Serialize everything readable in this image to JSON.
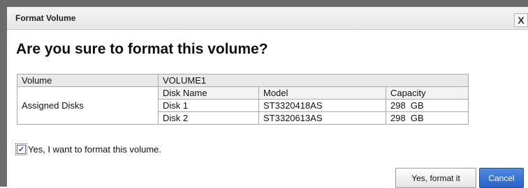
{
  "dialog": {
    "title": "Format Volume",
    "close_glyph": "X",
    "heading": "Are you sure to format this volume?"
  },
  "table": {
    "volume_label": "Volume",
    "volume_value": "VOLUME1",
    "assigned_label": "Assigned Disks",
    "disk_headers": [
      "Disk Name",
      "Model",
      "Capacity"
    ],
    "disks": [
      {
        "name": "Disk 1",
        "model": "ST3320418AS",
        "capacity": "298  GB"
      },
      {
        "name": "Disk 2",
        "model": "ST3320613AS",
        "capacity": "298  GB"
      }
    ]
  },
  "confirm": {
    "checked": true,
    "check_glyph": "✓",
    "label": "Yes, I want to format this volume."
  },
  "buttons": {
    "format_label": "Yes, format it",
    "cancel_label": "Cancel"
  },
  "colors": {
    "cancel_bg": "#2a62c8",
    "window_frame": "#6b6b6b"
  }
}
